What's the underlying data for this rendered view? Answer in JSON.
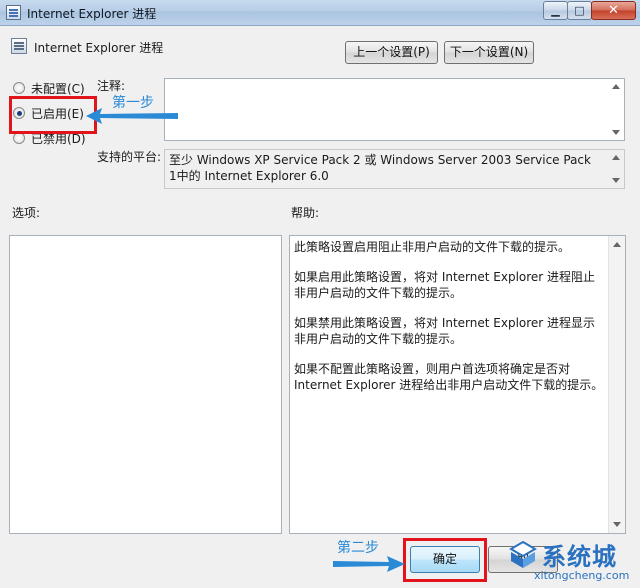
{
  "window": {
    "title": "Internet Explorer 进程",
    "min_label": "▁",
    "max_label": "□",
    "close_label": "✕"
  },
  "header": {
    "policy_title": "Internet Explorer 进程",
    "prev_button": "上一个设置(P)",
    "next_button": "下一个设置(N)"
  },
  "radios": [
    {
      "label": "未配置(C)",
      "selected": false
    },
    {
      "label": "已启用(E)",
      "selected": true
    },
    {
      "label": "已禁用(D)",
      "selected": false
    }
  ],
  "labels": {
    "comment": "注释:",
    "platform": "支持的平台:",
    "options": "选项:",
    "help": "帮助:"
  },
  "platform_text": "至少 Windows XP Service Pack 2 或 Windows Server 2003 Service Pack 1中的 Internet Explorer 6.0",
  "help_paragraphs": [
    "此策略设置启用阻止非用户启动的文件下载的提示。",
    "如果启用此策略设置，将对 Internet Explorer 进程阻止非用户启动的文件下载的提示。",
    "如果禁用此策略设置，将对 Internet Explorer 进程显示非用户启动的文件下载的提示。",
    "如果不配置此策略设置，则用户首选项将确定是否对 Internet Explorer 进程给出非用户启动文件下载的提示。"
  ],
  "footer": {
    "ok_button": "确定",
    "cancel_button": "取"
  },
  "annotations": {
    "step1": "第一步",
    "step2": "第二步",
    "color": "#e0151b",
    "arrow_color": "#2a8ad6"
  },
  "watermark": {
    "name": "系统城",
    "url": "xitongcheng.com"
  }
}
